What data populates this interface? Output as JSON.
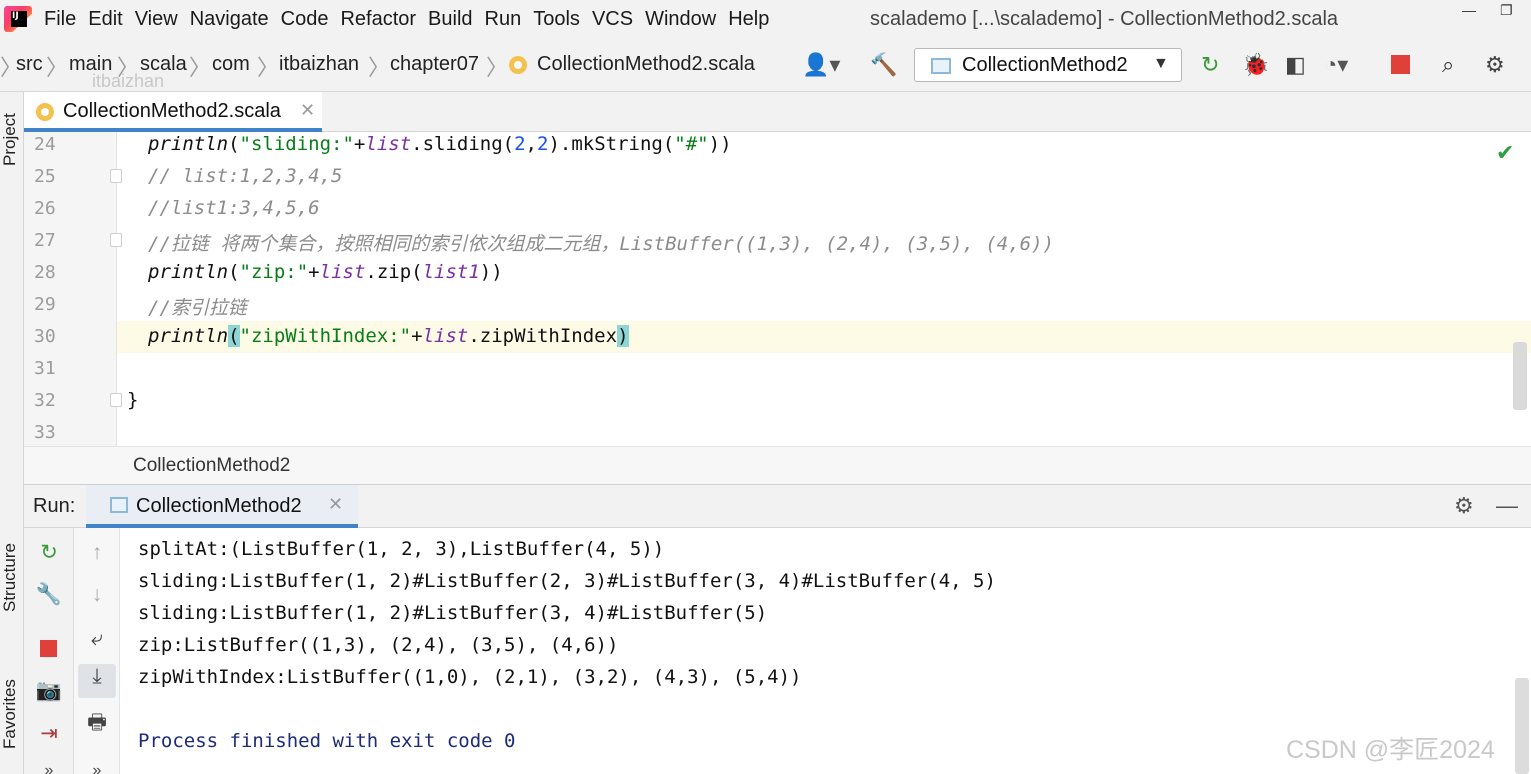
{
  "menu": {
    "items": [
      "File",
      "Edit",
      "View",
      "Navigate",
      "Code",
      "Refactor",
      "Build",
      "Run",
      "Tools",
      "VCS",
      "Window",
      "Help"
    ],
    "window_title": "scalademo [...\\scalademo] - CollectionMethod2.scala"
  },
  "breadcrumb": {
    "items": [
      "src",
      "main",
      "scala",
      "com",
      "itbaizhan",
      "chapter07",
      "CollectionMethod2.scala"
    ],
    "watermark": "itbaizhan"
  },
  "toolbar": {
    "run_config": "CollectionMethod2"
  },
  "side_tabs": {
    "project": "Project",
    "structure": "Structure",
    "favorites": "Favorites"
  },
  "editor": {
    "tab_label": "CollectionMethod2.scala",
    "line_numbers": [
      "24",
      "25",
      "26",
      "27",
      "28",
      "29",
      "30",
      "31",
      "32",
      "33"
    ],
    "lines": {
      "l24": {
        "fn": "println",
        "s1": "\"sliding:\"",
        "plus": "+",
        "var": "list",
        "m1": ".sliding(",
        "n1": "2",
        "comma": ",",
        "n2": "2",
        "m2": ").mkString(",
        "s2": "\"#\"",
        "end": "))"
      },
      "l25": "// list:1,2,3,4,5",
      "l26": "//list1:3,4,5,6",
      "l27": "//拉链 将两个集合，按照相同的索引依次组成二元组，ListBuffer((1,3), (2,4), (3,5), (4,6))",
      "l28": {
        "fn": "println",
        "open": "(",
        "s1": "\"zip:\"",
        "plus": "+",
        "var": "list",
        "m1": ".zip(",
        "var2": "list1",
        "end": "))"
      },
      "l29": "//索引拉链",
      "l30": {
        "fn": "println",
        "open": "(",
        "s1": "\"zipWithIndex:\"",
        "plus": "+",
        "var": "list",
        "m1": ".zipWithIndex",
        "end": ")"
      },
      "l32": "}"
    },
    "crumb": "CollectionMethod2"
  },
  "run_panel": {
    "label": "Run:",
    "tab_label": "CollectionMethod2",
    "output": [
      "splitAt:(ListBuffer(1, 2, 3),ListBuffer(4, 5))",
      "sliding:ListBuffer(1, 2)#ListBuffer(2, 3)#ListBuffer(3, 4)#ListBuffer(4, 5)",
      "sliding:ListBuffer(1, 2)#ListBuffer(3, 4)#ListBuffer(5)",
      "zip:ListBuffer((1,3), (2,4), (3,5), (4,6))",
      "zipWithIndex:ListBuffer((1,0), (2,1), (3,2), (4,3), (5,4))"
    ],
    "exit_message": "Process finished with exit code 0"
  },
  "watermark": "CSDN @李匠2024",
  "colors": {
    "accent": "#4083c9",
    "string": "#067d17",
    "number": "#1750eb",
    "variable": "#7a2fa3",
    "comment": "#8c8c8c"
  }
}
